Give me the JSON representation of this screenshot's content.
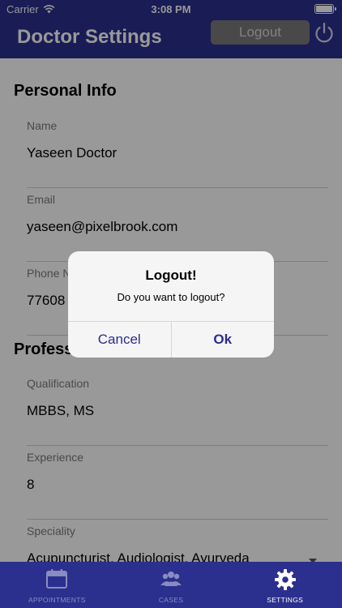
{
  "status_bar": {
    "carrier": "Carrier",
    "time": "3:08 PM"
  },
  "nav": {
    "title": "Doctor Settings",
    "logout_label": "Logout"
  },
  "sections": {
    "personal_info": "Personal Info",
    "professional": "Profess"
  },
  "fields": {
    "name": {
      "label": "Name",
      "value": "Yaseen Doctor"
    },
    "email": {
      "label": "Email",
      "value": "yaseen@pixelbrook.com"
    },
    "phone": {
      "label": "Phone N",
      "value": "77608"
    },
    "qualification": {
      "label": "Qualification",
      "value": "MBBS, MS"
    },
    "experience": {
      "label": "Experience",
      "value": "8"
    },
    "speciality": {
      "label": "Speciality",
      "value": "Acupuncturist, Audiologist, Ayurveda"
    }
  },
  "alert": {
    "title": "Logout!",
    "message": "Do you want to logout?",
    "cancel_label": "Cancel",
    "ok_label": "Ok"
  },
  "tabs": [
    {
      "label": "APPOINTMENTS",
      "icon": "calendar-icon",
      "active": false
    },
    {
      "label": "CASES",
      "icon": "people-icon",
      "active": false
    },
    {
      "label": "SETTINGS",
      "icon": "gear-icon",
      "active": true
    }
  ],
  "colors": {
    "brand": "#2b2f8e",
    "overlay": "rgba(0,0,0,0.4)",
    "logout_button_bg": "#7a7a7a",
    "inactive_tab": "#8a8cc0"
  }
}
